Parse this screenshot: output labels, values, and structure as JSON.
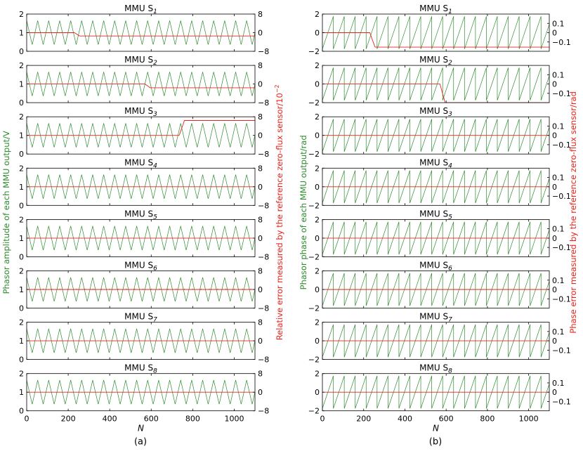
{
  "colors": {
    "amplitude": "#2e8b2e",
    "error": "#e8231c",
    "axis": "#000000"
  },
  "chart_data": [
    {
      "type": "line",
      "caption": "(a)",
      "xlabel": "N",
      "xlim": [
        0,
        1100
      ],
      "xticks": [
        "0",
        "200",
        "400",
        "600",
        "800",
        "1000"
      ],
      "ylabel_left": "Phasor amplitude of each MMU output/V",
      "ylabel_right": "Relative error measured by the reference zero-flux sensor/10",
      "ylabel_right_exponent": "−2",
      "ylim_left": [
        0,
        2
      ],
      "yticks_left": [
        "0",
        "1",
        "2"
      ],
      "ylim_right": [
        -8,
        8
      ],
      "yticks_right": [
        "−8",
        "0",
        "8"
      ],
      "series_green": {
        "kind": "triangle",
        "min": 0.35,
        "max": 1.65,
        "period": 53,
        "phase": 0
      },
      "panels": [
        {
          "title": "MMU S",
          "sub": "1",
          "error": {
            "before": 0,
            "after": -1.4,
            "step_x": 230
          }
        },
        {
          "title": "MMU S",
          "sub": "2",
          "error": {
            "before": 0,
            "after": -1.6,
            "step_x": 570
          }
        },
        {
          "title": "MMU S",
          "sub": "3",
          "error": {
            "before": 0,
            "after": 6.4,
            "step_x": 735
          }
        },
        {
          "title": "MMU S",
          "sub": "4",
          "error": {
            "before": 0,
            "after": 0,
            "step_x": null
          }
        },
        {
          "title": "MMU S",
          "sub": "5",
          "error": {
            "before": 0,
            "after": 0,
            "step_x": null
          }
        },
        {
          "title": "MMU S",
          "sub": "6",
          "error": {
            "before": 0,
            "after": 0,
            "step_x": null,
            "noise": true
          }
        },
        {
          "title": "MMU S",
          "sub": "7",
          "error": {
            "before": 0,
            "after": 0,
            "step_x": null
          }
        },
        {
          "title": "MMU S",
          "sub": "8",
          "error": {
            "before": 0,
            "after": 0,
            "step_x": null
          }
        }
      ]
    },
    {
      "type": "line",
      "caption": "(b)",
      "xlabel": "N",
      "xlim": [
        0,
        1100
      ],
      "xticks": [
        "0",
        "200",
        "400",
        "600",
        "800",
        "1000"
      ],
      "ylabel_left": "Phasor phase of each MMU output/rad",
      "ylabel_right": "Phase error measured by the reference zero-flux sensor/rad",
      "ylim_left": [
        -2,
        2
      ],
      "yticks_left": [
        "−2",
        "0",
        "2"
      ],
      "ylim_right": [
        -0.2,
        0.2
      ],
      "yticks_right": [
        "−0.1",
        "0",
        "0.1"
      ],
      "series_green": {
        "kind": "sawtooth",
        "min": -1.75,
        "max": 1.75,
        "period": 53,
        "phase": 0
      },
      "panels": [
        {
          "title": "MMU S",
          "sub": "1",
          "error": {
            "before": 0,
            "after": -0.155,
            "step_x": 230
          }
        },
        {
          "title": "MMU S",
          "sub": "2",
          "error": {
            "before": 0,
            "after": -0.2,
            "step_x": 570
          }
        },
        {
          "title": "MMU S",
          "sub": "3",
          "error": {
            "before": 0,
            "after": 0,
            "step_x": null
          }
        },
        {
          "title": "MMU S",
          "sub": "4",
          "error": {
            "before": 0,
            "after": 0,
            "step_x": null
          }
        },
        {
          "title": "MMU S",
          "sub": "5",
          "error": {
            "before": 0,
            "after": 0,
            "step_x": null
          }
        },
        {
          "title": "MMU S",
          "sub": "6",
          "error": {
            "before": 0,
            "after": 0,
            "step_x": null
          }
        },
        {
          "title": "MMU S",
          "sub": "7",
          "error": {
            "before": 0,
            "after": 0,
            "step_x": null
          }
        },
        {
          "title": "MMU S",
          "sub": "8",
          "error": {
            "before": 0,
            "after": 0,
            "step_x": null
          }
        }
      ]
    }
  ]
}
